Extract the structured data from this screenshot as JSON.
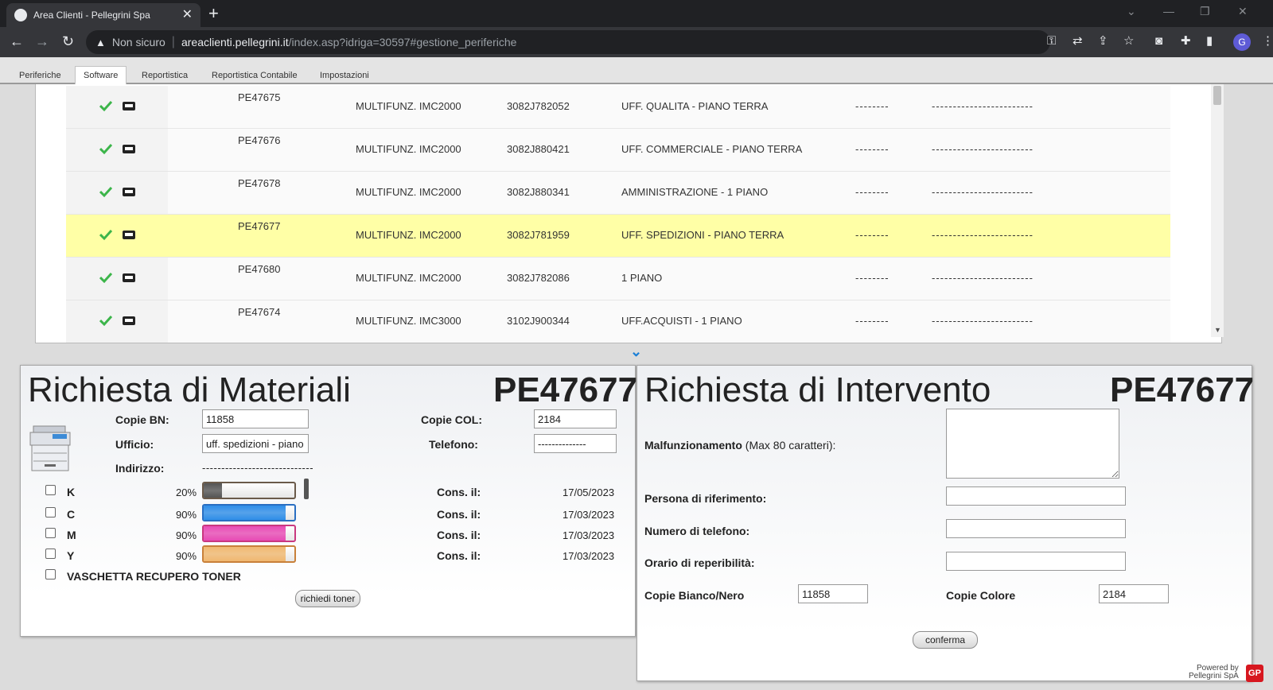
{
  "browser": {
    "tab_title": "Area Clienti - Pellegrini Spa",
    "new_tab": "+",
    "close": "✕",
    "insecure_label": "Non sicuro",
    "url_host": "areaclienti.pellegrini.it",
    "url_path": "/index.asp?idriga=30597#gestione_periferiche",
    "profile_initial": "G"
  },
  "app_tabs": [
    "Periferiche",
    "Software",
    "Reportistica",
    "Reportistica Contabile",
    "Impostazioni"
  ],
  "active_tab": "Software",
  "devices": [
    {
      "code": "PE47675",
      "model": "MULTIFUNZ. IMC2000",
      "serial": "3082J782052",
      "location": "UFF. QUALITA - PIANO TERRA",
      "d1": "--------",
      "d2": "------------------------"
    },
    {
      "code": "PE47676",
      "model": "MULTIFUNZ. IMC2000",
      "serial": "3082J880421",
      "location": "UFF. COMMERCIALE - PIANO TERRA",
      "d1": "--------",
      "d2": "------------------------"
    },
    {
      "code": "PE47678",
      "model": "MULTIFUNZ. IMC2000",
      "serial": "3082J880341",
      "location": "AMMINISTRAZIONE - 1 PIANO",
      "d1": "--------",
      "d2": "------------------------"
    },
    {
      "code": "PE47677",
      "model": "MULTIFUNZ. IMC2000",
      "serial": "3082J781959",
      "location": "UFF. SPEDIZIONI - PIANO TERRA",
      "d1": "--------",
      "d2": "------------------------"
    },
    {
      "code": "PE47680",
      "model": "MULTIFUNZ. IMC2000",
      "serial": "3082J782086",
      "location": "1 PIANO",
      "d1": "--------",
      "d2": "------------------------"
    },
    {
      "code": "PE47674",
      "model": "MULTIFUNZ. IMC3000",
      "serial": "3102J900344",
      "location": "UFF.ACQUISTI - 1 PIANO",
      "d1": "--------",
      "d2": "------------------------"
    }
  ],
  "materials": {
    "title": "Richiesta di Materiali",
    "code": "PE47677",
    "copie_bn_label": "Copie BN:",
    "copie_bn_value": "11858",
    "copie_col_label": "Copie COL:",
    "copie_col_value": "2184",
    "ufficio_label": "Ufficio:",
    "ufficio_value": "uff. spedizioni - piano terra",
    "telefono_label": "Telefono:",
    "telefono_value": "--------------",
    "indirizzo_label": "Indirizzo:",
    "indirizzo_value": "-----------------------------",
    "cons_label": "Cons. il:",
    "toners": [
      {
        "name": "K",
        "percent": "20%",
        "level": 0.2,
        "date": "17/05/2023",
        "color": "#555555"
      },
      {
        "name": "C",
        "percent": "90%",
        "level": 0.9,
        "date": "17/03/2023",
        "color": "#2f8ee8"
      },
      {
        "name": "M",
        "percent": "90%",
        "level": 0.9,
        "date": "17/03/2023",
        "color": "#e84bb5"
      },
      {
        "name": "Y",
        "percent": "90%",
        "level": 0.9,
        "date": "17/03/2023",
        "color": "#f0b870"
      }
    ],
    "waste_label": "VASCHETTA RECUPERO TONER",
    "button": "richiedi toner"
  },
  "intervention": {
    "title": "Richiesta di Intervento",
    "code": "PE47677",
    "malfunction_label": "Malfunzionamento",
    "malfunction_hint": "(Max 80 caratteri):",
    "persona_label": "Persona di riferimento:",
    "telefono_label": "Numero di telefono:",
    "orario_label": "Orario di reperibilità:",
    "copie_bn_label": "Copie Bianco/Nero",
    "copie_bn_value": "11858",
    "copie_col_label": "Copie Colore",
    "copie_col_value": "2184",
    "button": "conferma"
  },
  "footer": {
    "powered_line1": "Powered by",
    "powered_line2": "Pellegrini SpA"
  }
}
